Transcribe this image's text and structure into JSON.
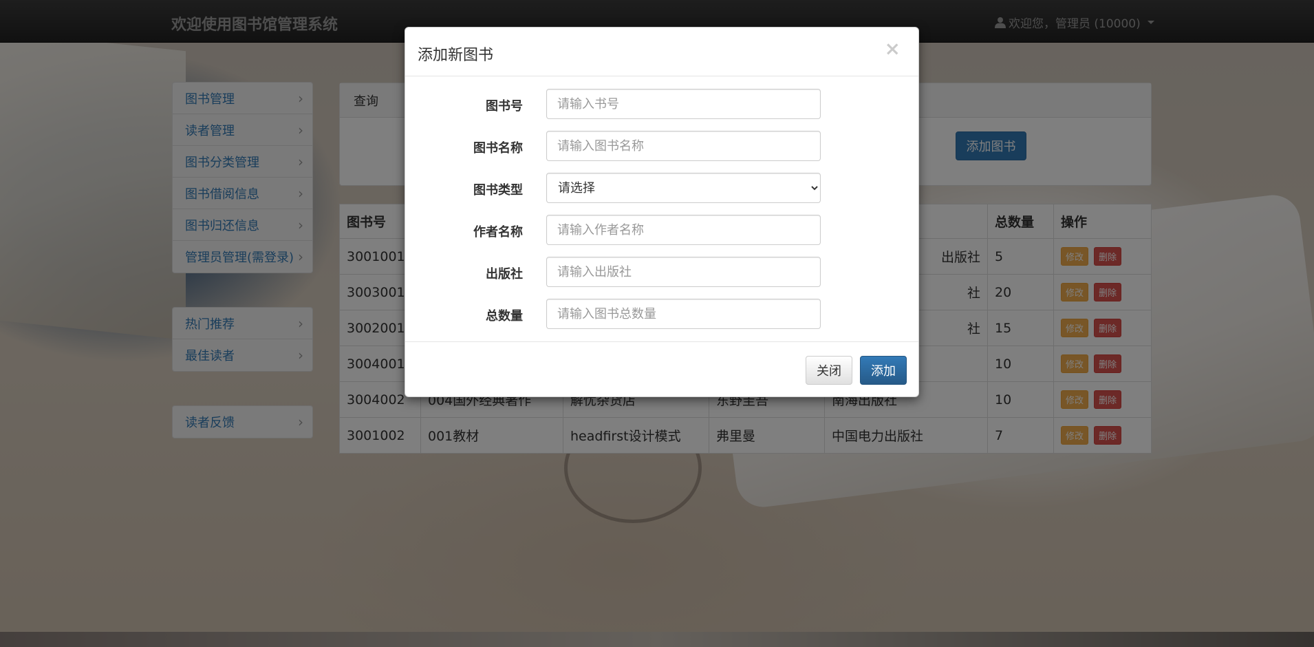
{
  "navbar": {
    "brand": "欢迎使用图书馆管理系统",
    "user_label": "欢迎您，管理员 (10000)"
  },
  "sidebar": {
    "group1": [
      {
        "label": "图书管理"
      },
      {
        "label": "读者管理"
      },
      {
        "label": "图书分类管理"
      },
      {
        "label": "图书借阅信息"
      },
      {
        "label": "图书归还信息"
      },
      {
        "label": "管理员管理(需登录)"
      }
    ],
    "group2": [
      {
        "label": "热门推荐"
      },
      {
        "label": "最佳读者"
      }
    ],
    "group3": [
      {
        "label": "读者反馈"
      }
    ]
  },
  "query": {
    "title": "查询",
    "add_button": "添加图书"
  },
  "table": {
    "headers": [
      "图书号",
      "",
      "",
      "",
      "",
      "总数量",
      "操作"
    ],
    "rows": [
      {
        "id": "3001001",
        "cat": "",
        "name": "",
        "author": "",
        "publisher": "出版社",
        "total": "5"
      },
      {
        "id": "3003001",
        "cat": "",
        "name": "",
        "author": "",
        "publisher": "社",
        "total": "20"
      },
      {
        "id": "3002001",
        "cat": "",
        "name": "",
        "author": "",
        "publisher": "社",
        "total": "15"
      },
      {
        "id": "3004001",
        "cat": "",
        "name": "",
        "author": "",
        "publisher": "",
        "total": "10"
      },
      {
        "id": "3004002",
        "cat": "004国外经典著作",
        "name": "解忧杂货店",
        "author": "东野圭吾",
        "publisher": "南海出版社",
        "total": "10"
      },
      {
        "id": "3001002",
        "cat": "001教材",
        "name": "headfirst设计模式",
        "author": "弗里曼",
        "publisher": "中国电力出版社",
        "total": "7"
      }
    ],
    "edit_label": "修改",
    "delete_label": "删除"
  },
  "modal": {
    "title": "添加新图书",
    "close_symbol": "×",
    "fields": {
      "book_id": {
        "label": "图书号",
        "placeholder": "请输入书号"
      },
      "book_name": {
        "label": "图书名称",
        "placeholder": "请输入图书名称"
      },
      "book_type": {
        "label": "图书类型",
        "selected": "请选择"
      },
      "author": {
        "label": "作者名称",
        "placeholder": "请输入作者名称"
      },
      "publisher": {
        "label": "出版社",
        "placeholder": "请输入出版社"
      },
      "total": {
        "label": "总数量",
        "placeholder": "请输入图书总数量"
      }
    },
    "close_button": "关闭",
    "submit_button": "添加"
  }
}
